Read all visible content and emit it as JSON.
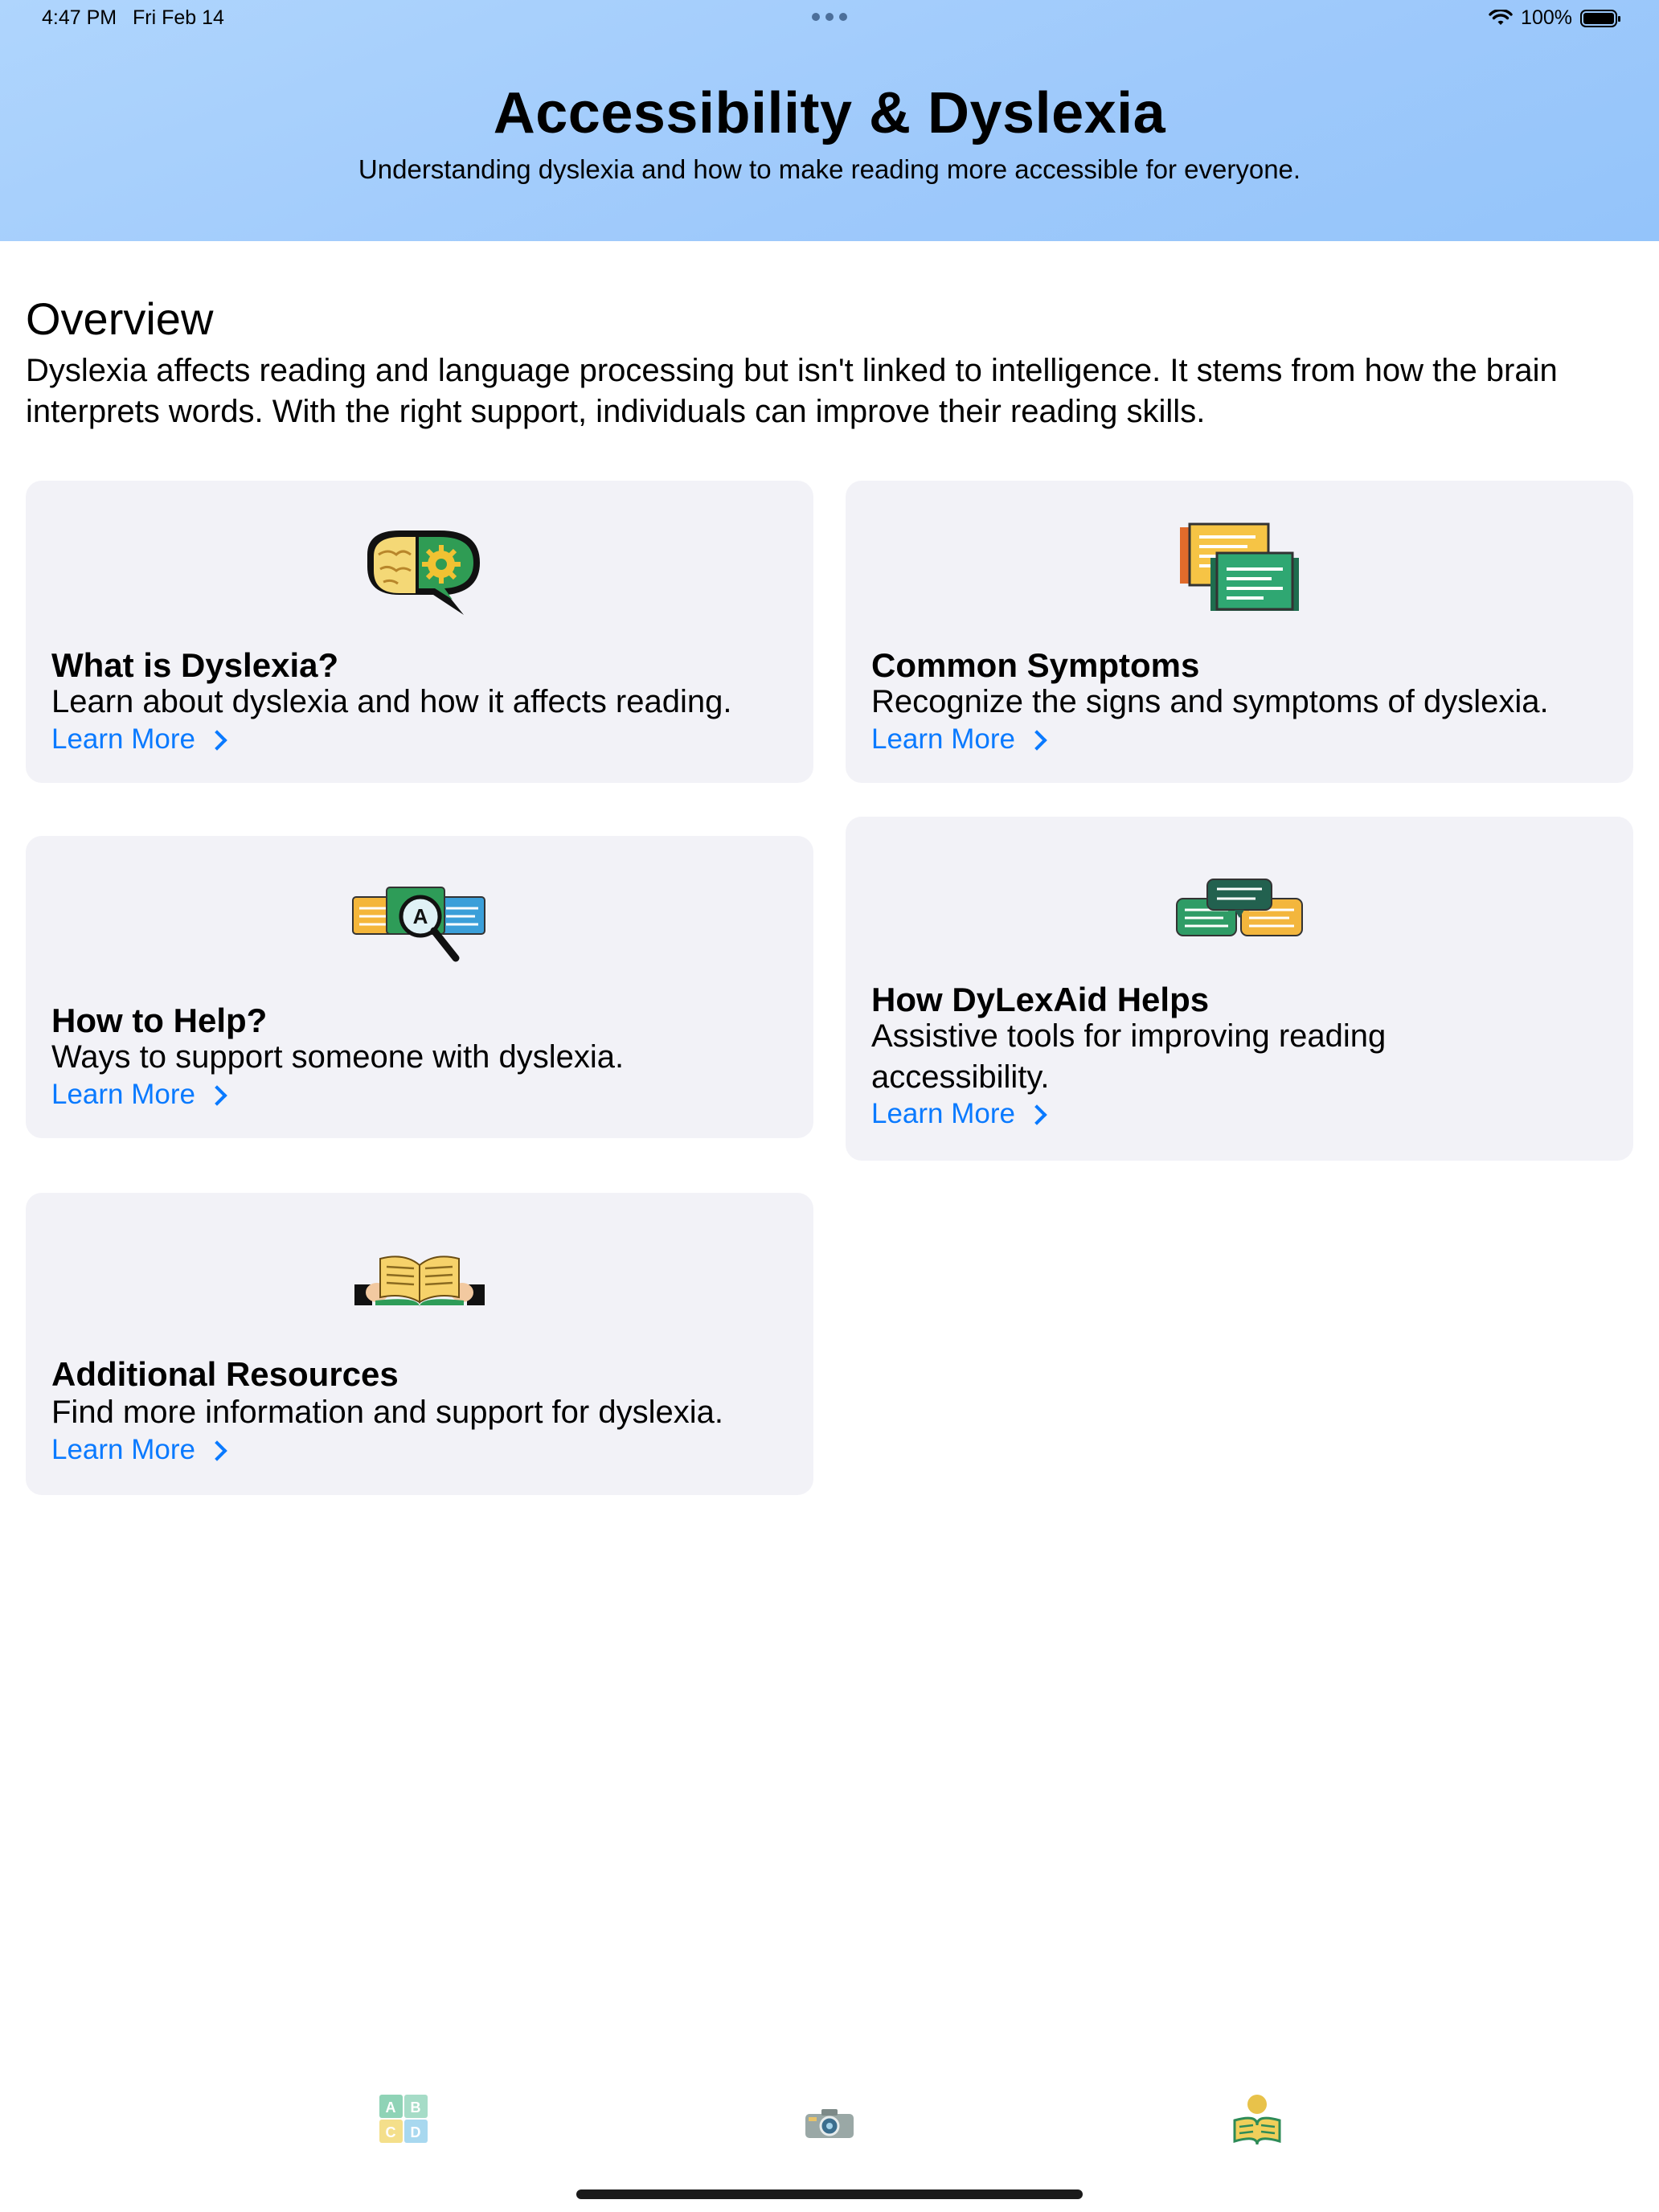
{
  "status_bar": {
    "time": "4:47 PM",
    "date": "Fri Feb 14",
    "battery": "100%"
  },
  "header": {
    "title": "Accessibility & Dyslexia",
    "subtitle": "Understanding dyslexia and how to make reading more accessible for everyone."
  },
  "overview": {
    "title": "Overview",
    "text": "Dyslexia affects reading and language processing but isn't linked to intelligence. It stems from how the brain interprets words. With the right support, individuals can improve their reading skills."
  },
  "cards": [
    {
      "icon": "brain-gear-icon",
      "title": "What is Dyslexia?",
      "description": "Learn about dyslexia and how it affects reading.",
      "link": "Learn More"
    },
    {
      "icon": "scrolls-icon",
      "title": "Common Symptoms",
      "description": "Recognize the signs and symptoms of dyslexia.",
      "link": "Learn More"
    },
    {
      "icon": "speech-bubbles-magnifier-icon",
      "title": "How to Help?",
      "description": "Ways to support someone with dyslexia.",
      "link": "Learn More"
    },
    {
      "icon": "chat-bubbles-icon",
      "title": "How DyLexAid Helps",
      "description": "Assistive tools for improving reading accessibility.",
      "link": "Learn More"
    },
    {
      "icon": "open-book-hands-icon",
      "title": "Additional Resources",
      "description": "Find more information and support for dyslexia.",
      "link": "Learn More"
    }
  ],
  "tab_bar": [
    {
      "icon": "abcd-blocks-icon",
      "label": "A B C D"
    },
    {
      "icon": "camera-icon"
    },
    {
      "icon": "reader-icon"
    }
  ],
  "colors": {
    "header_gradient": "#afd5fd",
    "card_bg": "#f2f2f7",
    "link": "#0a7aff"
  }
}
